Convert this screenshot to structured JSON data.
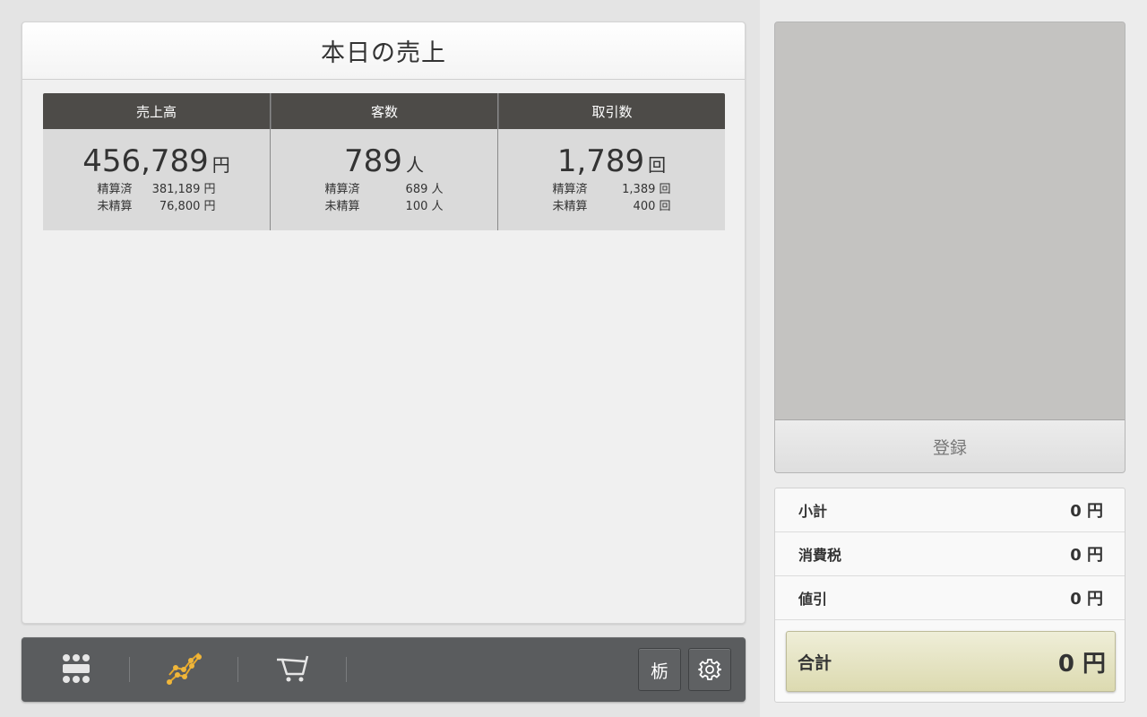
{
  "sales_panel": {
    "title": "本日の売上",
    "stats": [
      {
        "header": "売上高",
        "value": "456,789",
        "unit": "円",
        "settled_label": "精算済",
        "settled_value": "381,189 円",
        "unsettled_label": "未精算",
        "unsettled_value": "76,800 円"
      },
      {
        "header": "客数",
        "value": "789",
        "unit": "人",
        "settled_label": "精算済",
        "settled_value": "689 人",
        "unsettled_label": "未精算",
        "unsettled_value": "100 人"
      },
      {
        "header": "取引数",
        "value": "1,789",
        "unit": "回",
        "settled_label": "精算済",
        "settled_value": "1,389 回",
        "unsettled_label": "未精算",
        "unsettled_value": "400 回"
      }
    ]
  },
  "toolbar": {
    "items": [
      {
        "icon": "grid-menu-icon"
      },
      {
        "icon": "sales-chart-icon",
        "active": true,
        "color": "#e0a020"
      },
      {
        "icon": "cart-icon"
      }
    ],
    "store_button_label": "栃",
    "settings_icon": "gear-icon"
  },
  "register": {
    "button_label": "登録"
  },
  "totals": {
    "rows": [
      {
        "label": "小計",
        "amount": "0 円"
      },
      {
        "label": "消費税",
        "amount": "0 円"
      },
      {
        "label": "値引",
        "amount": "0 円"
      }
    ],
    "total_label": "合計",
    "total_amount": "0 円"
  }
}
